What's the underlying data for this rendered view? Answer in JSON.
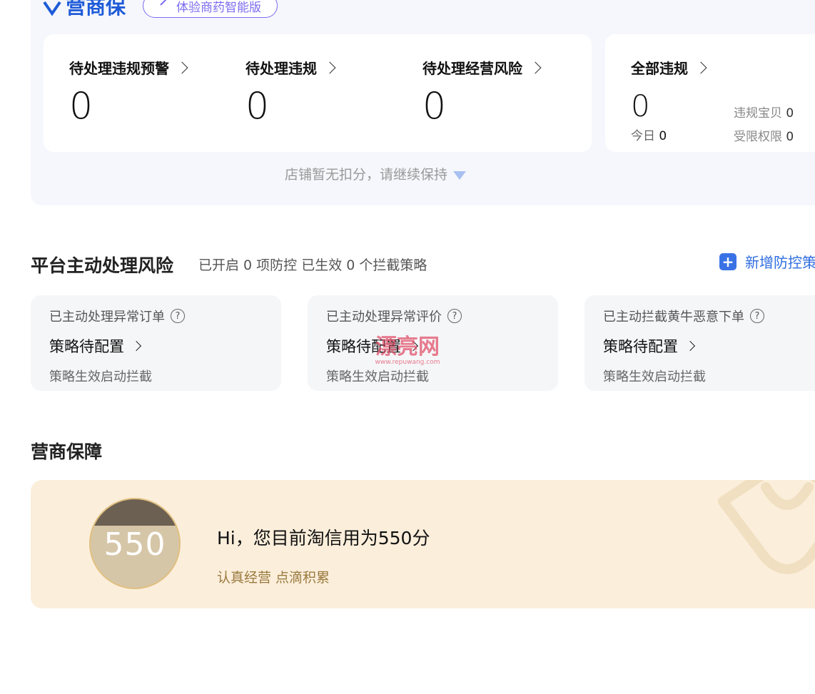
{
  "brand": {
    "name": "营商保",
    "pill_label": "体验商药智能版"
  },
  "stats": [
    {
      "title": "待处理违规预警",
      "value": "0"
    },
    {
      "title": "待处理违规",
      "value": "0"
    },
    {
      "title": "待处理经营风险",
      "value": "0"
    }
  ],
  "all_violations": {
    "title": "全部违规",
    "value": "0",
    "today_label": "今日",
    "today_value": "0",
    "items": [
      {
        "label": "违规宝贝",
        "value": "0"
      },
      {
        "label": "受限权限",
        "value": "0"
      }
    ]
  },
  "footnote": "店铺暂无扣分，请继续保持",
  "platform_risk": {
    "title": "平台主动处理风险",
    "subtitle": "已开启 0 项防控 已生效 0 个拦截策略",
    "new_button": "新增防控策",
    "cards": [
      {
        "label": "已主动处理异常订单",
        "state": "策略待配置",
        "note": "策略生效启动拦截"
      },
      {
        "label": "已主动处理异常评价",
        "state": "策略待配置",
        "note": "策略生效启动拦截"
      },
      {
        "label": "已主动拦截黄牛恶意下单",
        "state": "策略待配置",
        "note": "策略生效启动拦截"
      }
    ]
  },
  "watermark": {
    "text": "漂亮网",
    "url": "www.repuwang.com"
  },
  "guarantee": {
    "title": "营商保障",
    "score": "550",
    "message": "Hi，您目前淘信用为550分",
    "slogan": "认真经营 点滴积累"
  }
}
